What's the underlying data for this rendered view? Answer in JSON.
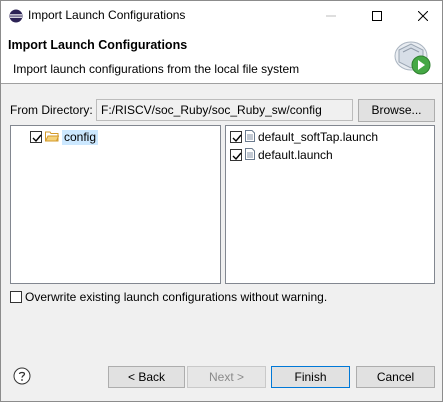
{
  "window": {
    "title": "Import Launch Configurations"
  },
  "banner": {
    "title": "Import Launch Configurations",
    "description": "Import launch configurations from the local file system",
    "icon": "import-wizard-icon"
  },
  "directory": {
    "label": "From Directory:",
    "value": "F:/RISCV/soc_Ruby/soc_Ruby_sw/config",
    "browse_label": "Browse..."
  },
  "folders": [
    {
      "label": "config",
      "checked": true,
      "icon": "folder-icon"
    }
  ],
  "files": [
    {
      "label": "default_softTap.launch",
      "checked": true,
      "icon": "file-icon"
    },
    {
      "label": "default.launch",
      "checked": true,
      "icon": "file-icon"
    }
  ],
  "options": {
    "overwrite_label": "Overwrite existing launch configurations without warning.",
    "overwrite_checked": false
  },
  "buttons": {
    "back": "< Back",
    "next": "Next >",
    "finish": "Finish",
    "cancel": "Cancel"
  },
  "colors": {
    "selection": "#cce8ff",
    "default_button_border": "#0078d7",
    "folder": "#e8b44a"
  }
}
